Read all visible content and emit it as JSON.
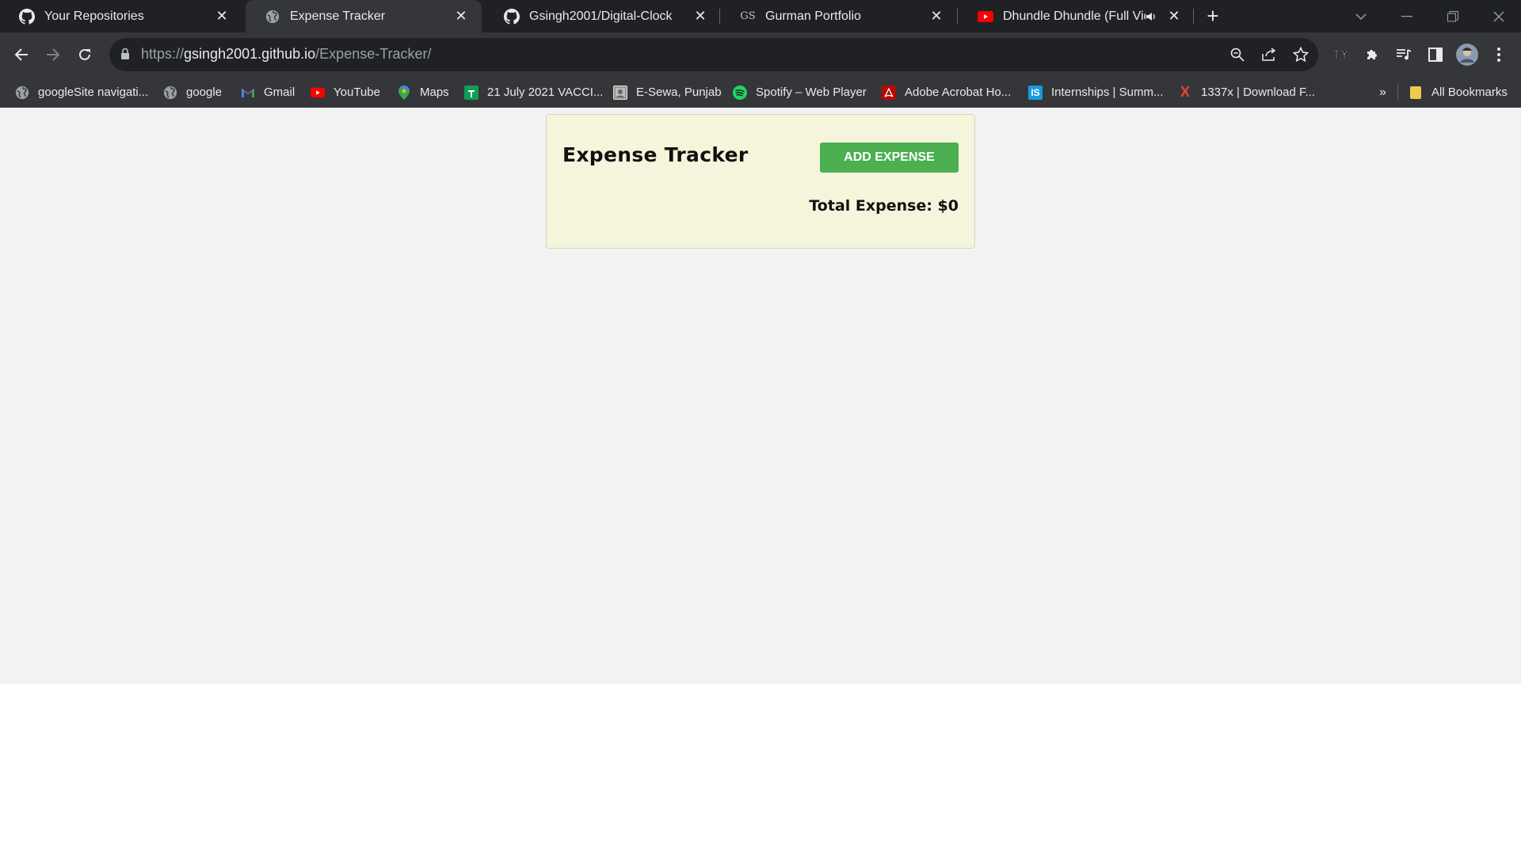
{
  "tabs": [
    {
      "title": "Your Repositories",
      "icon": "github-icon"
    },
    {
      "title": "Expense Tracker",
      "icon": "globe-icon",
      "active": true
    },
    {
      "title": "Gsingh2001/Digital-Clock",
      "icon": "github-icon"
    },
    {
      "title": "Gurman Portfolio",
      "icon": "gs-favicon",
      "icon_text": "GS"
    },
    {
      "title": "Dhundle Dhundle (Full Vide",
      "icon": "youtube-icon"
    }
  ],
  "address_bar": {
    "scheme": "https://",
    "host": "gsingh2001.github.io",
    "path": "/Expense-Tracker/"
  },
  "bookmarks": [
    {
      "label": "googleSite navigati...",
      "icon": "globe-icon"
    },
    {
      "label": "google",
      "icon": "globe-icon"
    },
    {
      "label": "Gmail",
      "icon": "gmail-icon"
    },
    {
      "label": "YouTube",
      "icon": "youtube-icon"
    },
    {
      "label": "Maps",
      "icon": "maps-icon"
    },
    {
      "label": "21 July 2021 VACCI...",
      "icon": "sheets-icon"
    },
    {
      "label": "E-Sewa, Punjab",
      "icon": "esewa-icon"
    },
    {
      "label": "Spotify – Web Player",
      "icon": "spotify-icon"
    },
    {
      "label": "Adobe Acrobat Ho...",
      "icon": "acrobat-icon"
    },
    {
      "label": "Internships | Summ...",
      "icon": "internshala-icon",
      "icon_text": "IS"
    },
    {
      "label": "1337x | Download F...",
      "icon": "x-icon",
      "icon_text": "X"
    }
  ],
  "bookmarks_overflow": "»",
  "all_bookmarks": "All Bookmarks",
  "app": {
    "title": "Expense Tracker",
    "add_button": "ADD EXPENSE",
    "total_label": "Total Expense: $0"
  },
  "colors": {
    "card_bg": "#f5f5dc",
    "button_green": "#4caf50",
    "page_bg": "#f2f2f2",
    "chrome_dark": "#202124",
    "chrome_toolbar": "#35363a"
  }
}
